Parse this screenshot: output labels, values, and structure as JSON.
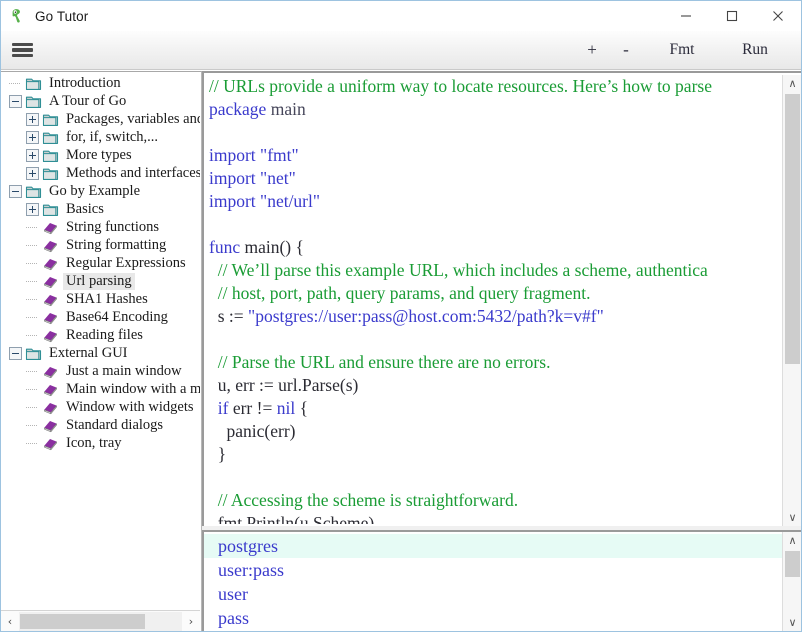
{
  "window": {
    "title": "Go Tutor",
    "app_icon": "gopher-icon",
    "controls": {
      "minimize": "minimize-icon",
      "maximize": "maximize-icon",
      "close": "close-icon"
    }
  },
  "toolbar": {
    "menu_icon": "hamburger-icon",
    "zoom_in": "+",
    "zoom_out": "-",
    "format": "Fmt",
    "run": "Run"
  },
  "sidebar": {
    "scrollbar": {
      "left_arrow": "‹",
      "right_arrow": "›"
    },
    "items": [
      {
        "label": "Introduction",
        "depth": 1,
        "type": "folder",
        "expander": "none",
        "selected": false
      },
      {
        "label": "A Tour of Go",
        "depth": 1,
        "type": "folder",
        "expander": "minus",
        "selected": false
      },
      {
        "label": "Packages, variables and",
        "depth": 2,
        "type": "folder",
        "expander": "plus",
        "selected": false
      },
      {
        "label": "for, if, switch,...",
        "depth": 2,
        "type": "folder",
        "expander": "plus",
        "selected": false
      },
      {
        "label": "More types",
        "depth": 2,
        "type": "folder",
        "expander": "plus",
        "selected": false
      },
      {
        "label": "Methods and interfaces",
        "depth": 2,
        "type": "folder",
        "expander": "plus",
        "selected": false
      },
      {
        "label": "Go by Example",
        "depth": 1,
        "type": "folder",
        "expander": "minus",
        "selected": false
      },
      {
        "label": "Basics",
        "depth": 2,
        "type": "folder",
        "expander": "plus",
        "selected": false
      },
      {
        "label": "String functions",
        "depth": 2,
        "type": "leaf",
        "expander": "none",
        "selected": false
      },
      {
        "label": "String formatting",
        "depth": 2,
        "type": "leaf",
        "expander": "none",
        "selected": false
      },
      {
        "label": "Regular Expressions",
        "depth": 2,
        "type": "leaf",
        "expander": "none",
        "selected": false
      },
      {
        "label": "Url parsing",
        "depth": 2,
        "type": "leaf",
        "expander": "none",
        "selected": true
      },
      {
        "label": "SHA1 Hashes",
        "depth": 2,
        "type": "leaf",
        "expander": "none",
        "selected": false
      },
      {
        "label": "Base64 Encoding",
        "depth": 2,
        "type": "leaf",
        "expander": "none",
        "selected": false
      },
      {
        "label": "Reading files",
        "depth": 2,
        "type": "leaf",
        "expander": "none",
        "selected": false
      },
      {
        "label": "External GUI",
        "depth": 1,
        "type": "folder",
        "expander": "minus",
        "selected": false
      },
      {
        "label": "Just a main window",
        "depth": 2,
        "type": "leaf",
        "expander": "none",
        "selected": false
      },
      {
        "label": "Main window with a m",
        "depth": 2,
        "type": "leaf",
        "expander": "none",
        "selected": false
      },
      {
        "label": "Window with widgets",
        "depth": 2,
        "type": "leaf",
        "expander": "none",
        "selected": false
      },
      {
        "label": "Standard dialogs",
        "depth": 2,
        "type": "leaf",
        "expander": "none",
        "selected": false
      },
      {
        "label": "Icon, tray",
        "depth": 2,
        "type": "leaf",
        "expander": "none",
        "selected": false
      }
    ]
  },
  "editor": {
    "lines": [
      [
        {
          "t": "// URLs provide a uniform way to locate resources. Here’s how to parse",
          "c": "cm"
        }
      ],
      [
        {
          "t": "package ",
          "c": "kw"
        },
        {
          "t": "main",
          "c": "id"
        }
      ],
      [
        {
          "t": "",
          "c": "pl"
        }
      ],
      [
        {
          "t": "import ",
          "c": "kw"
        },
        {
          "t": "\"fmt\"",
          "c": "st"
        }
      ],
      [
        {
          "t": "import ",
          "c": "kw"
        },
        {
          "t": "\"net\"",
          "c": "st"
        }
      ],
      [
        {
          "t": "import ",
          "c": "kw"
        },
        {
          "t": "\"net/url\"",
          "c": "st"
        }
      ],
      [
        {
          "t": "",
          "c": "pl"
        }
      ],
      [
        {
          "t": "func ",
          "c": "kw"
        },
        {
          "t": "main() {",
          "c": "pl"
        }
      ],
      [
        {
          "t": "  // We’ll parse this example URL, which includes a scheme, authentica",
          "c": "cm"
        }
      ],
      [
        {
          "t": "  // host, port, path, query params, and query fragment.",
          "c": "cm"
        }
      ],
      [
        {
          "t": "  s := ",
          "c": "pl"
        },
        {
          "t": "\"postgres://user:pass@host.com:5432/path?k=v#f\"",
          "c": "st"
        }
      ],
      [
        {
          "t": "",
          "c": "pl"
        }
      ],
      [
        {
          "t": "  // Parse the URL and ensure there are no errors.",
          "c": "cm"
        }
      ],
      [
        {
          "t": "  u, err := url.Parse(s)",
          "c": "pl"
        }
      ],
      [
        {
          "t": "  if ",
          "c": "kw"
        },
        {
          "t": "err != ",
          "c": "pl"
        },
        {
          "t": "nil",
          "c": "kw"
        },
        {
          "t": " {",
          "c": "pl"
        }
      ],
      [
        {
          "t": "    panic(err)",
          "c": "pl"
        }
      ],
      [
        {
          "t": "  }",
          "c": "pl"
        }
      ],
      [
        {
          "t": "",
          "c": "pl"
        }
      ],
      [
        {
          "t": "  // Accessing the scheme is straightforward.",
          "c": "cm"
        }
      ],
      [
        {
          "t": "  fmt.Println(u.Scheme)",
          "c": "pl"
        }
      ]
    ],
    "scrollbar": {
      "up_arrow": "∧",
      "down_arrow": "∨"
    }
  },
  "output": {
    "lines": [
      {
        "text": "postgres",
        "highlighted": true
      },
      {
        "text": "user:pass",
        "highlighted": false
      },
      {
        "text": "user",
        "highlighted": false
      },
      {
        "text": "pass",
        "highlighted": false
      }
    ],
    "scrollbar": {
      "up_arrow": "∧",
      "down_arrow": "∨"
    }
  },
  "colors": {
    "comment": "#1a9c35",
    "keyword": "#3a3acc",
    "string": "#3a3acc",
    "plain": "#2b2b33",
    "output_text": "#3a3acc",
    "output_highlight": "#e6fbf5",
    "window_border": "#9dc3e0",
    "selection": "#e8e8e8"
  }
}
